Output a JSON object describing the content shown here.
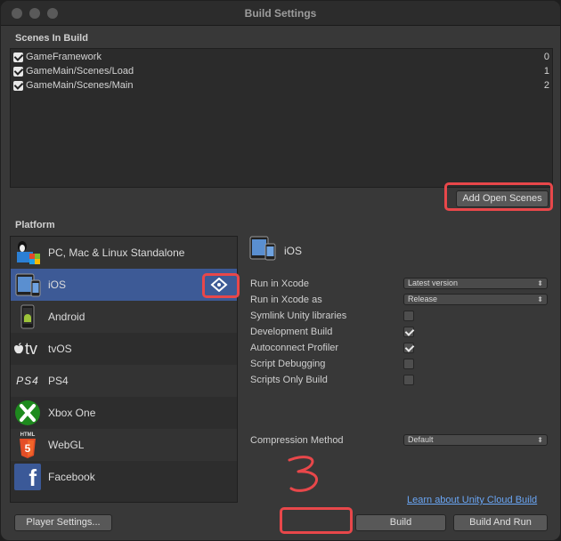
{
  "window": {
    "title": "Build Settings"
  },
  "scenes": {
    "header": "Scenes In Build",
    "items": [
      {
        "name": "GameFramework",
        "index": "0"
      },
      {
        "name": "GameMain/Scenes/Load",
        "index": "1"
      },
      {
        "name": "GameMain/Scenes/Main",
        "index": "2"
      }
    ],
    "add_open_scenes_label": "Add Open Scenes"
  },
  "platform": {
    "header": "Platform",
    "items": [
      {
        "label": "PC, Mac & Linux Standalone",
        "icon": "pc-mac-linux-icon"
      },
      {
        "label": "iOS",
        "icon": "ios-device-icon",
        "selected": true
      },
      {
        "label": "Android",
        "icon": "android-icon"
      },
      {
        "label": "tvOS",
        "icon": "appletv-icon"
      },
      {
        "label": "PS4",
        "icon": "ps4-icon"
      },
      {
        "label": "Xbox One",
        "icon": "xbox-icon"
      },
      {
        "label": "WebGL",
        "icon": "html5-icon"
      },
      {
        "label": "Facebook",
        "icon": "facebook-icon"
      }
    ],
    "selected_title": "iOS",
    "tvos_logo_text": "tv",
    "ps4_logo_text": "PS4",
    "html5_logo_text": "HTML",
    "html5_digit": "5",
    "facebook_logo_text": "f"
  },
  "options": {
    "run_in_xcode": {
      "label": "Run in Xcode",
      "value": "Latest version"
    },
    "run_in_xcode_as": {
      "label": "Run in Xcode as",
      "value": "Release"
    },
    "symlink": {
      "label": "Symlink Unity libraries",
      "checked": false
    },
    "development_build": {
      "label": "Development Build",
      "checked": true
    },
    "autoconnect_profiler": {
      "label": "Autoconnect Profiler",
      "checked": true
    },
    "script_debugging": {
      "label": "Script Debugging",
      "checked": false
    },
    "scripts_only_build": {
      "label": "Scripts Only Build",
      "checked": false
    },
    "compression": {
      "label": "Compression Method",
      "value": "Default"
    }
  },
  "footer": {
    "cloud_build_link": "Learn about Unity Cloud Build",
    "player_settings_label": "Player Settings...",
    "build_label": "Build",
    "build_and_run_label": "Build And Run"
  },
  "annotation": {
    "text": "3",
    "color": "#e8474a"
  },
  "colors": {
    "highlight": "#e8474a",
    "selected_row": "#3d5a96",
    "link": "#6aa6f5"
  }
}
